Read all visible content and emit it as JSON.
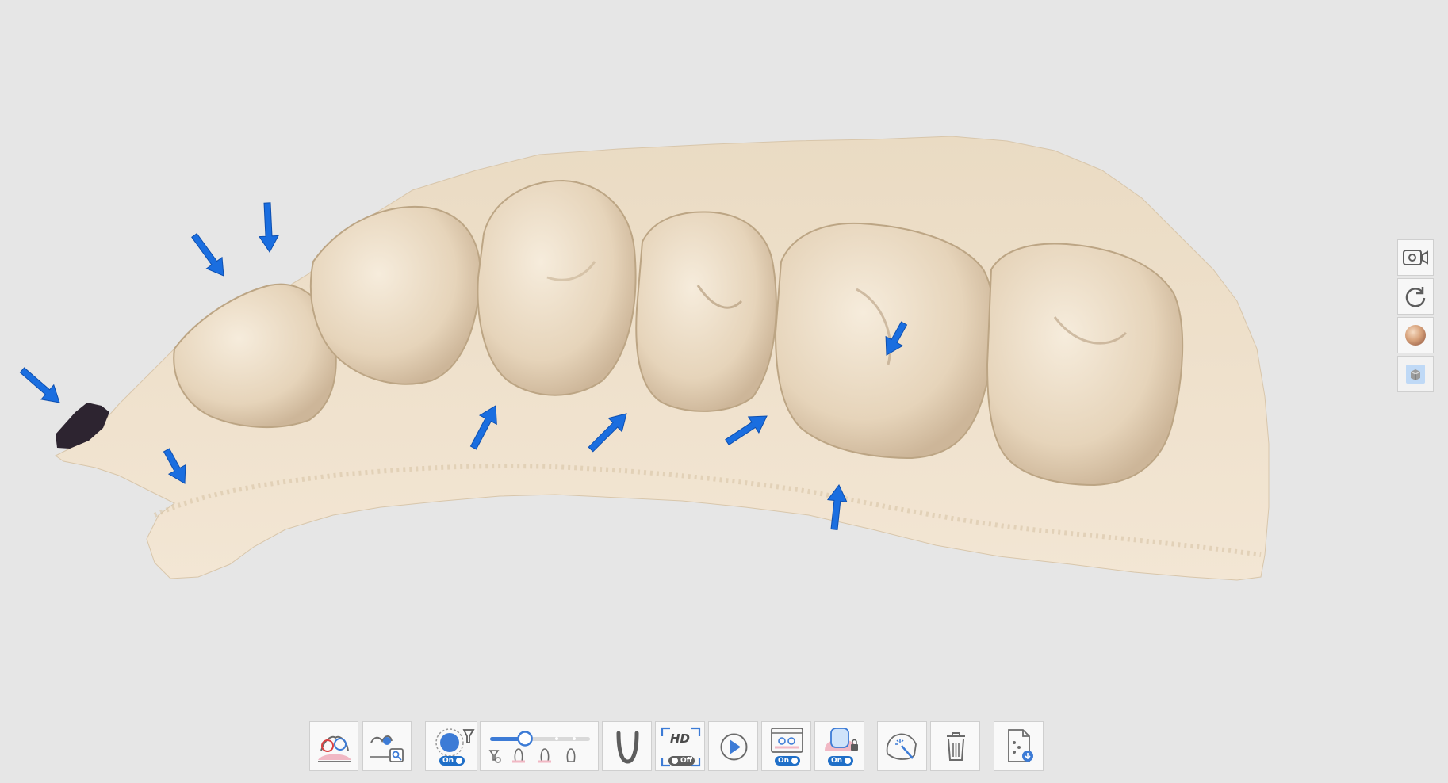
{
  "viewport": {
    "model": "dental-scan-model",
    "model_color": "#ecdcc4",
    "marker_color": "#1a6ee0",
    "background": "#e6e6e6"
  },
  "side_toolbar": [
    {
      "name": "record-camera-icon"
    },
    {
      "name": "reset-view-icon"
    },
    {
      "name": "texture-sphere-icon"
    },
    {
      "name": "view-cube-icon"
    }
  ],
  "bottom_toolbar": {
    "smart_scan_filter": {
      "toggle_label": "On"
    },
    "hd_mode": {
      "label": "HD",
      "toggle_label": "Off"
    },
    "scan_range": {
      "toggle_label": "On"
    },
    "tray_mode": {
      "toggle_label": "On"
    },
    "filter_slider": {
      "level": 0.35
    }
  }
}
